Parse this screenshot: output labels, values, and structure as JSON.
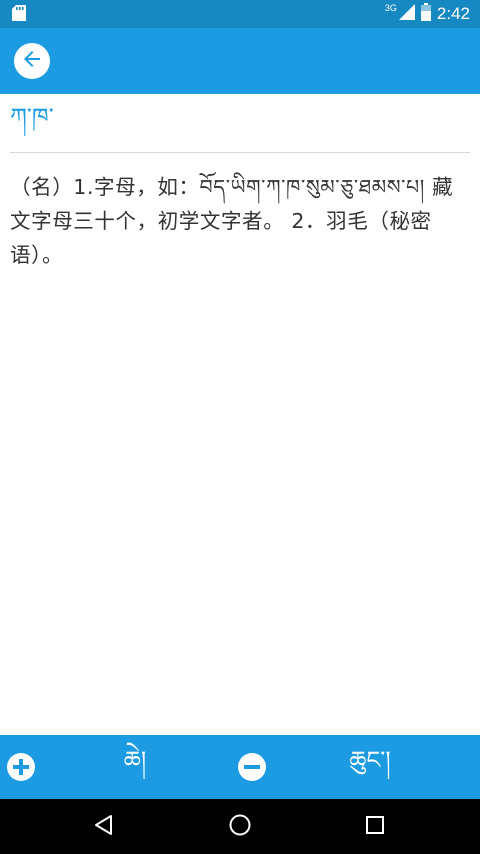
{
  "status_bar": {
    "network": "3G",
    "time": "2:42"
  },
  "app_bar": {
    "back_icon": "arrow-left-icon"
  },
  "entry": {
    "headword": "ཀ་ཁ་",
    "definition": "（名）1.字母，如：བོད་ཡིག་ཀ་ཁ་སུམ་ཅུ་ཐམས་པ། 藏文字母三十个，初学文字者。 2．羽毛（秘密语）。"
  },
  "toolbar": {
    "zoom_in_icon": "plus-circle-icon",
    "button_left_label": "ཆེ།",
    "zoom_out_icon": "minus-circle-icon",
    "button_right_label": "ཆུང་།"
  },
  "colors": {
    "status_bar": "#1688c2",
    "primary": "#1d9be2",
    "text": "#333333",
    "nav_bar": "#000000"
  }
}
